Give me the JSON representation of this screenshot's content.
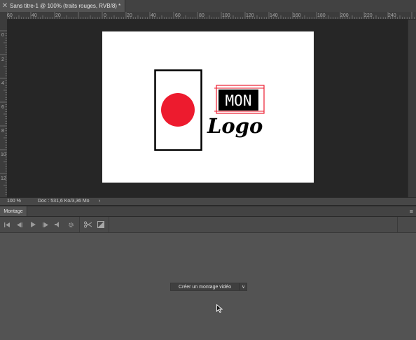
{
  "document_tab": {
    "close_glyph": "✕",
    "title": "Sans titre-1 @ 100% (traits rouges, RVB/8) *"
  },
  "ruler": {
    "h_labels": [
      "60",
      "40",
      "20",
      "0",
      "20",
      "40",
      "60",
      "80",
      "100",
      "120",
      "140",
      "160",
      "180",
      "200",
      "220",
      "240"
    ],
    "v_labels": [
      "0",
      "2",
      "4",
      "6",
      "8",
      "10",
      "12"
    ]
  },
  "canvas_art": {
    "logo_word_1": "MON",
    "logo_word_2": "Logo",
    "accent_color": "#ed1b2e",
    "ink_color": "#000000"
  },
  "status": {
    "zoom": "100 %",
    "doc_info": "Doc : 531,6 Ko/3,36 Mo",
    "arrow": "›"
  },
  "panel": {
    "tab_label": "Montage",
    "menu_glyph": "≡",
    "toolbar_icons": [
      "go-to-first-frame-icon",
      "previous-frame-icon",
      "play-icon",
      "next-frame-icon",
      "mute-audio-icon",
      "settings-gear-icon",
      "split-scissors-icon",
      "transition-icon"
    ],
    "create_button_label": "Créer un montage vidéo",
    "dropdown_glyph": "∨"
  }
}
